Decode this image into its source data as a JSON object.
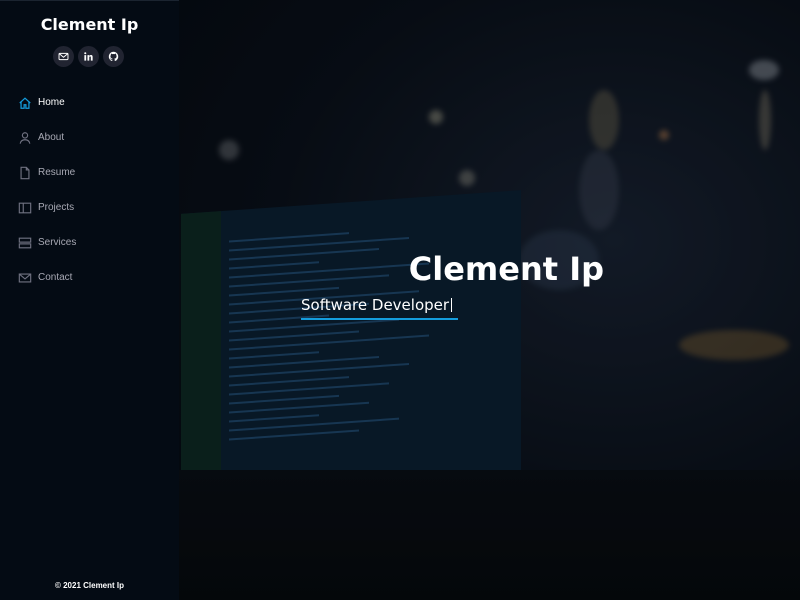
{
  "sidebar": {
    "name": "Clement Ip",
    "social": [
      {
        "icon": "email-icon"
      },
      {
        "icon": "linkedin-icon"
      },
      {
        "icon": "github-icon"
      }
    ],
    "nav": [
      {
        "label": "Home",
        "icon": "home-icon",
        "active": true
      },
      {
        "label": "About",
        "icon": "user-icon",
        "active": false
      },
      {
        "label": "Resume",
        "icon": "file-icon",
        "active": false
      },
      {
        "label": "Projects",
        "icon": "book-icon",
        "active": false
      },
      {
        "label": "Services",
        "icon": "server-icon",
        "active": false
      },
      {
        "label": "Contact",
        "icon": "envelope-icon",
        "active": false
      }
    ],
    "footer": "© 2021 Clement Ip"
  },
  "hero": {
    "title": "Clement Ip",
    "subtitle": "Software Developer"
  },
  "colors": {
    "accent": "#149ddd",
    "sidebar_bg": "#040b14",
    "nav_text": "#a8a9b4"
  }
}
